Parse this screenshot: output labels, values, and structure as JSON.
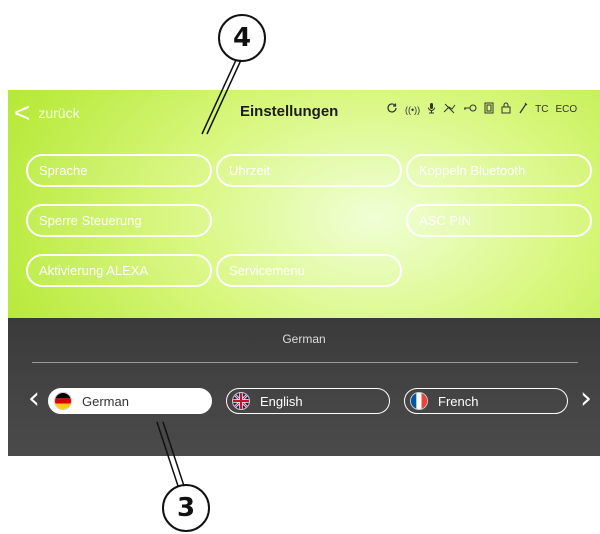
{
  "callouts": {
    "top": "4",
    "bottom": "3"
  },
  "header": {
    "back_label": "zurück",
    "title": "Einstellungen",
    "status_icons": [
      "sync-icon",
      "signal-icon",
      "microphone-icon",
      "no-spray-icon",
      "key-icon",
      "battery-icon",
      "lock-icon",
      "tool-icon"
    ],
    "tc_label": "TC",
    "eco_label": "ECO"
  },
  "settings": [
    {
      "label": "Sprache"
    },
    {
      "label": "Uhrzeit"
    },
    {
      "label": "Koppeln Bluetooth"
    },
    {
      "label": "Sperre Steuerung"
    },
    {
      "label": "ASC PIN"
    },
    {
      "label": "Aktivierung ALEXA"
    },
    {
      "label": "Servicemenu"
    }
  ],
  "language": {
    "current": "German",
    "options": [
      {
        "label": "German",
        "flag": "de-flag",
        "selected": true
      },
      {
        "label": "English",
        "flag": "uk-flag",
        "selected": false
      },
      {
        "label": "French",
        "flag": "fr-flag",
        "selected": false
      }
    ]
  },
  "colors": {
    "screen_green": "#b9ea3d",
    "panel_dark": "#3d3d3d",
    "button_outline": "#ffffff"
  }
}
